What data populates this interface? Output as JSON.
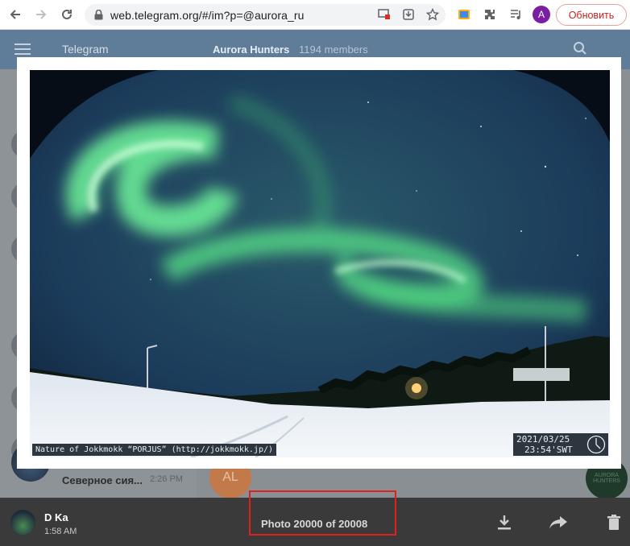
{
  "browser": {
    "url": "web.telegram.org/#/im?p=@aurora_ru",
    "profile_initial": "A",
    "update_label": "Обновить"
  },
  "app": {
    "title": "Telegram",
    "chat_title": "Aurora Hunters",
    "chat_members": "1194 members",
    "visible_chat": {
      "name": "Северное сия...",
      "time": "2:26 PM"
    },
    "al_initials": "AL"
  },
  "photo": {
    "caption": "Nature of Jokkmokk “PORJUS” (http://jokkmokk.jp/)",
    "date": "2021/03/25",
    "time": "23:54'SWT"
  },
  "viewer": {
    "sender_name": "D Ka",
    "sender_time": "1:58 AM",
    "counter": "Photo 20000 of 20008",
    "highlight_color": "#e0201c"
  },
  "icons": [
    "back-icon",
    "forward-icon",
    "reload-icon",
    "lock-icon",
    "cast-blocked-icon",
    "install-icon",
    "star-icon",
    "screenshot-icon",
    "extensions-icon",
    "media-icon",
    "download-icon",
    "forward-share-icon",
    "delete-icon",
    "menu-icon",
    "search-icon"
  ]
}
